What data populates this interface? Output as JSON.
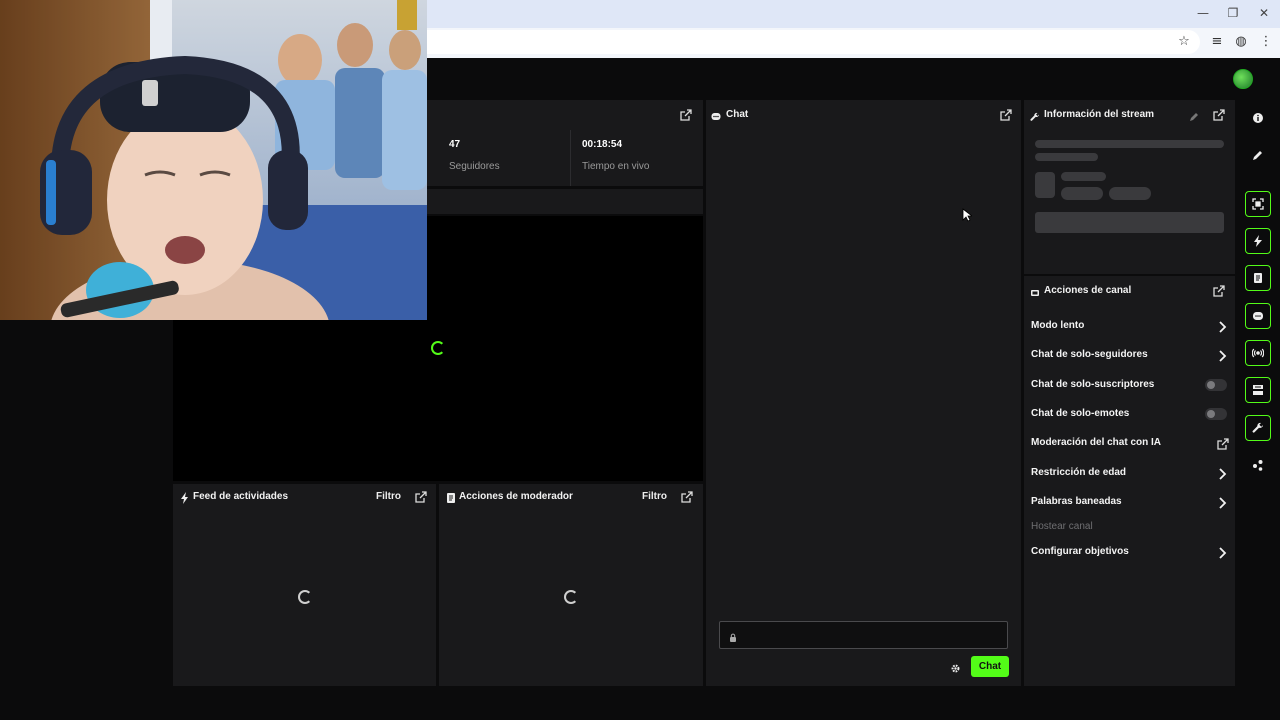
{
  "browser": {
    "controls": {
      "minimize": "—",
      "restore": "❐",
      "close": "✕"
    },
    "icons": [
      "star-icon",
      "media-control-icon",
      "profile-icon",
      "menu-icon"
    ]
  },
  "stats": [
    {
      "value": "47",
      "label": "Seguidores"
    },
    {
      "value": "00:18:54",
      "label": "Tiempo en vivo"
    }
  ],
  "activity_feed": {
    "title": "Feed de actividades",
    "filter": "Filtro"
  },
  "mod_actions": {
    "title": "Acciones de moderador",
    "filter": "Filtro"
  },
  "chat": {
    "title": "Chat",
    "send_label": "Chat",
    "input_value": ""
  },
  "stream_info": {
    "title": "Información del stream"
  },
  "channel_actions": {
    "title": "Acciones de canal",
    "items": [
      {
        "label": "Modo lento",
        "control": "chevron"
      },
      {
        "label": "Chat de solo-seguidores",
        "control": "chevron"
      },
      {
        "label": "Chat de solo-suscriptores",
        "control": "toggle",
        "on": false
      },
      {
        "label": "Chat de solo-emotes",
        "control": "toggle",
        "on": false
      },
      {
        "label": "Moderación del chat con IA",
        "control": "external"
      },
      {
        "label": "Restricción de edad",
        "control": "chevron"
      },
      {
        "label": "Palabras baneadas",
        "control": "chevron"
      },
      {
        "label": "Hostear canal",
        "control": "none",
        "disabled": true
      },
      {
        "label": "Configurar objetivos",
        "control": "chevron"
      }
    ]
  },
  "colors": {
    "accent": "#53fc18",
    "panel": "#19191b",
    "background": "#0b0b0c"
  },
  "rail_icons": [
    "info-icon",
    "pencil-icon",
    "scan-icon",
    "lightning-icon",
    "document-icon",
    "chat-bubble-icon",
    "broadcast-icon",
    "layout-icon",
    "wrench-icon",
    "share-icon"
  ]
}
